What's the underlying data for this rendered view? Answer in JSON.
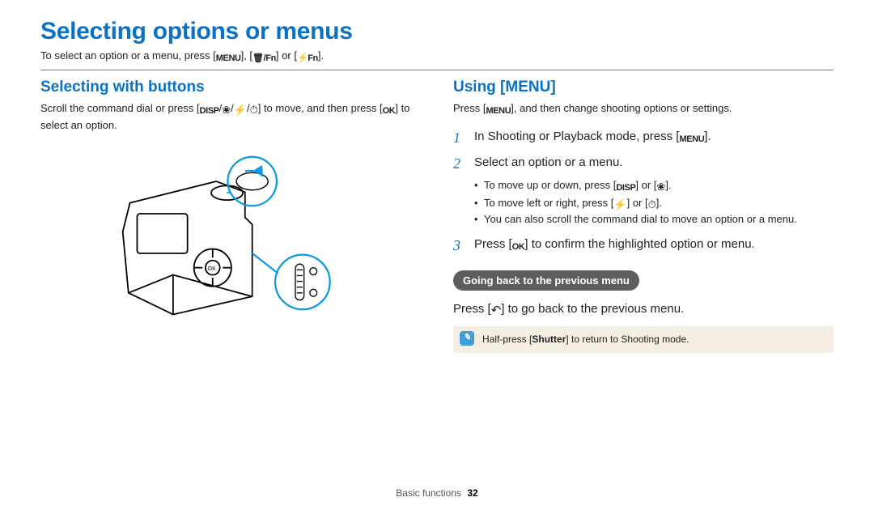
{
  "page_title": "Selecting options or menus",
  "intro": {
    "prefix": "To select an option or a menu, press [",
    "menu_label": "MENU",
    "mid1": "], [",
    "trash_fn": "🗑/Fn",
    "mid2": "] or [",
    "flash_fn": "⚡Fn",
    "suffix": "]."
  },
  "left": {
    "heading": "Selecting with buttons",
    "body_prefix": "Scroll the command dial or press [",
    "disp": "DISP",
    "sep": "/",
    "macro": "❀",
    "flash": "⚡",
    "timer": "⏱",
    "body_mid": "] to move, and then press [",
    "ok": "OK",
    "body_suffix": "] to select an option."
  },
  "right": {
    "heading": "Using [MENU]",
    "intro_prefix": "Press [",
    "menu_label": "MENU",
    "intro_suffix": "], and then change shooting options or settings.",
    "step1_prefix": "In Shooting or Playback mode, press [",
    "step1_suffix": "].",
    "step2": "Select an option or a menu.",
    "sub1_prefix": "To move up or down, press [",
    "sub1_mid": "] or [",
    "sub1_suffix": "].",
    "sub2_prefix": "To move left or right, press [",
    "sub2_mid": "] or [",
    "sub2_suffix": "].",
    "sub3": "You can also scroll the command dial to move an option or a menu.",
    "step3_prefix": "Press [",
    "step3_suffix": "] to confirm the highlighted option or menu.",
    "pill": "Going back to the previous menu",
    "back_prefix": "Press [",
    "back_icon": "↶",
    "back_suffix": "] to go back to the previous menu.",
    "note_prefix": "Half-press [",
    "note_bold": "Shutter",
    "note_suffix": "] to return to Shooting mode."
  },
  "footer": {
    "section": "Basic functions",
    "page_number": "32"
  }
}
